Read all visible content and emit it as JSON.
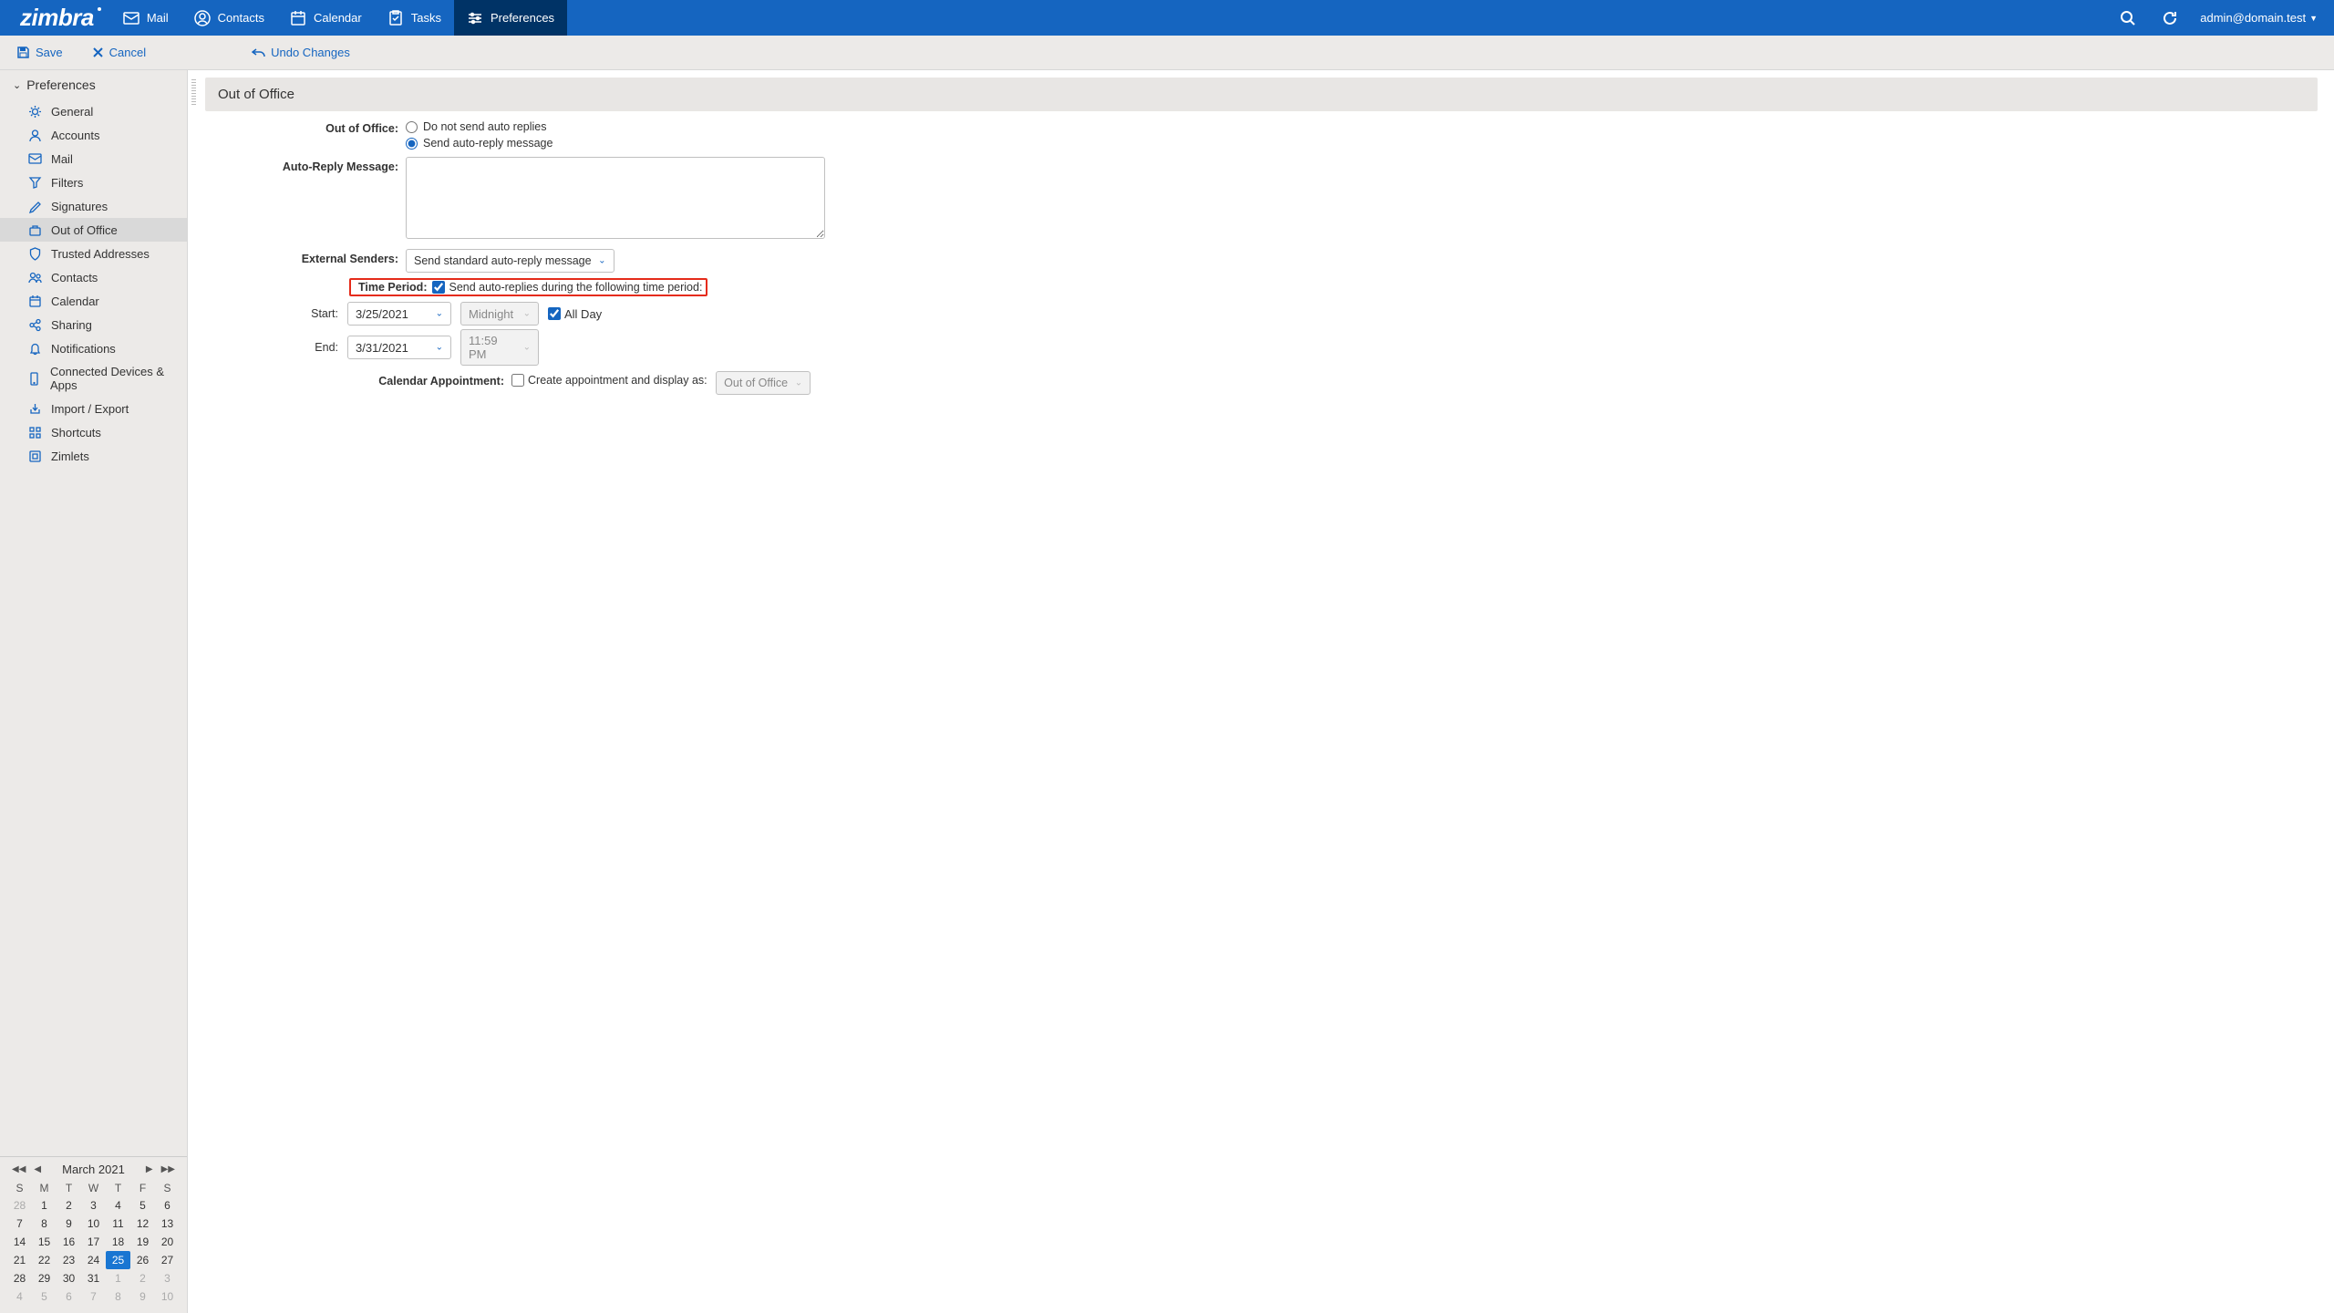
{
  "nav": {
    "logo": "zimbra",
    "items": [
      "Mail",
      "Contacts",
      "Calendar",
      "Tasks",
      "Preferences"
    ],
    "user": "admin@domain.test"
  },
  "actions": {
    "save": "Save",
    "cancel": "Cancel",
    "undo": "Undo Changes"
  },
  "sidebar": {
    "header": "Preferences",
    "items": [
      "General",
      "Accounts",
      "Mail",
      "Filters",
      "Signatures",
      "Out of Office",
      "Trusted Addresses",
      "Contacts",
      "Calendar",
      "Sharing",
      "Notifications",
      "Connected Devices & Apps",
      "Import / Export",
      "Shortcuts",
      "Zimlets"
    ]
  },
  "panel": {
    "title": "Out of Office",
    "labels": {
      "ooo": "Out of Office:",
      "msg": "Auto-Reply Message:",
      "ext": "External Senders:",
      "time": "Time Period:",
      "start": "Start:",
      "end": "End:",
      "cal": "Calendar Appointment:"
    },
    "radio_no": "Do not send auto replies",
    "radio_send": "Send auto-reply message",
    "ext_value": "Send standard auto-reply message",
    "time_check": "Send auto-replies during the following time period:",
    "start_date": "3/25/2021",
    "start_time": "Midnight",
    "all_day": "All Day",
    "end_date": "3/31/2021",
    "end_time": "11:59 PM",
    "cal_check": "Create appointment and display as:",
    "cal_value": "Out of Office"
  },
  "minical": {
    "title": "March 2021",
    "dow": [
      "S",
      "M",
      "T",
      "W",
      "T",
      "F",
      "S"
    ],
    "days": [
      {
        "n": "28",
        "m": true
      },
      {
        "n": "1"
      },
      {
        "n": "2"
      },
      {
        "n": "3"
      },
      {
        "n": "4"
      },
      {
        "n": "5"
      },
      {
        "n": "6"
      },
      {
        "n": "7"
      },
      {
        "n": "8"
      },
      {
        "n": "9"
      },
      {
        "n": "10"
      },
      {
        "n": "11"
      },
      {
        "n": "12"
      },
      {
        "n": "13"
      },
      {
        "n": "14"
      },
      {
        "n": "15"
      },
      {
        "n": "16"
      },
      {
        "n": "17"
      },
      {
        "n": "18"
      },
      {
        "n": "19"
      },
      {
        "n": "20"
      },
      {
        "n": "21"
      },
      {
        "n": "22"
      },
      {
        "n": "23"
      },
      {
        "n": "24"
      },
      {
        "n": "25",
        "today": true
      },
      {
        "n": "26"
      },
      {
        "n": "27"
      },
      {
        "n": "28"
      },
      {
        "n": "29"
      },
      {
        "n": "30"
      },
      {
        "n": "31"
      },
      {
        "n": "1",
        "m": true
      },
      {
        "n": "2",
        "m": true
      },
      {
        "n": "3",
        "m": true
      },
      {
        "n": "4",
        "m": true
      },
      {
        "n": "5",
        "m": true
      },
      {
        "n": "6",
        "m": true
      },
      {
        "n": "7",
        "m": true
      },
      {
        "n": "8",
        "m": true
      },
      {
        "n": "9",
        "m": true
      },
      {
        "n": "10",
        "m": true
      }
    ]
  }
}
